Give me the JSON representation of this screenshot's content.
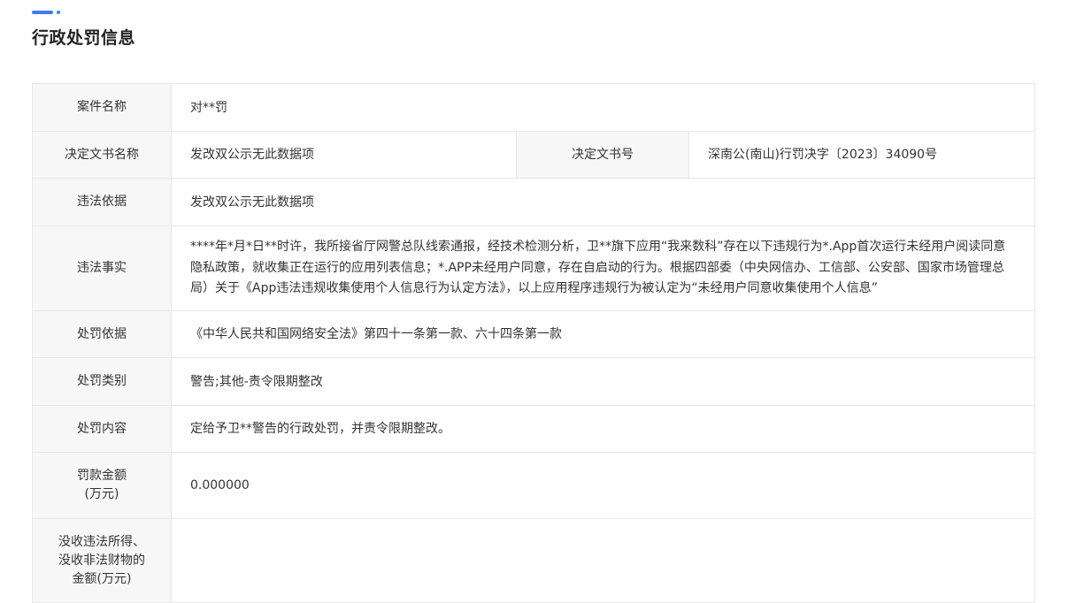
{
  "section": {
    "title": "行政处罚信息"
  },
  "colors": {
    "accent": "#3d7cf5",
    "label_bg": "#f7f7f7",
    "border": "#e8e8e8",
    "text": "#333333"
  },
  "rows": {
    "case_name": {
      "label": "案件名称",
      "value": "对**罚"
    },
    "decision_doc": {
      "label": "决定文书名称",
      "value": "发改双公示无此数据项",
      "number_label": "决定文书号",
      "number_value": "深南公(南山)行罚决字〔2023〕34090号"
    },
    "violation_basis": {
      "label": "违法依据",
      "value": "发改双公示无此数据项"
    },
    "violation_facts": {
      "label": "违法事实",
      "value": "****年*月*日**时许，我所接省厅网警总队线索通报，经技术检测分析，卫**旗下应用“我来数科”存在以下违规行为*.App首次运行未经用户阅读同意隐私政策，就收集正在运行的应用列表信息；*.APP未经用户同意，存在自启动的行为。根据四部委（中央网信办、工信部、公安部、国家市场管理总局）关于《App违法违规收集使用个人信息行为认定方法》，以上应用程序违规行为被认定为“未经用户同意收集使用个人信息”"
    },
    "penalty_basis": {
      "label": "处罚依据",
      "value": "《中华人民共和国网络安全法》第四十一条第一款、六十四条第一款"
    },
    "penalty_type": {
      "label": "处罚类别",
      "value": "警告;其他-责令限期整改"
    },
    "penalty_content": {
      "label": "处罚内容",
      "value": "定给予卫**警告的行政处罚，并责令限期整改。"
    },
    "fine_amount": {
      "label_line1": "罚款金额",
      "label_line2": "(万元)",
      "value": "0.000000"
    },
    "confiscation": {
      "label_line1": "没收违法所得、",
      "label_line2": "没收非法财物的",
      "label_line3": "金额(万元)",
      "value": ""
    }
  }
}
